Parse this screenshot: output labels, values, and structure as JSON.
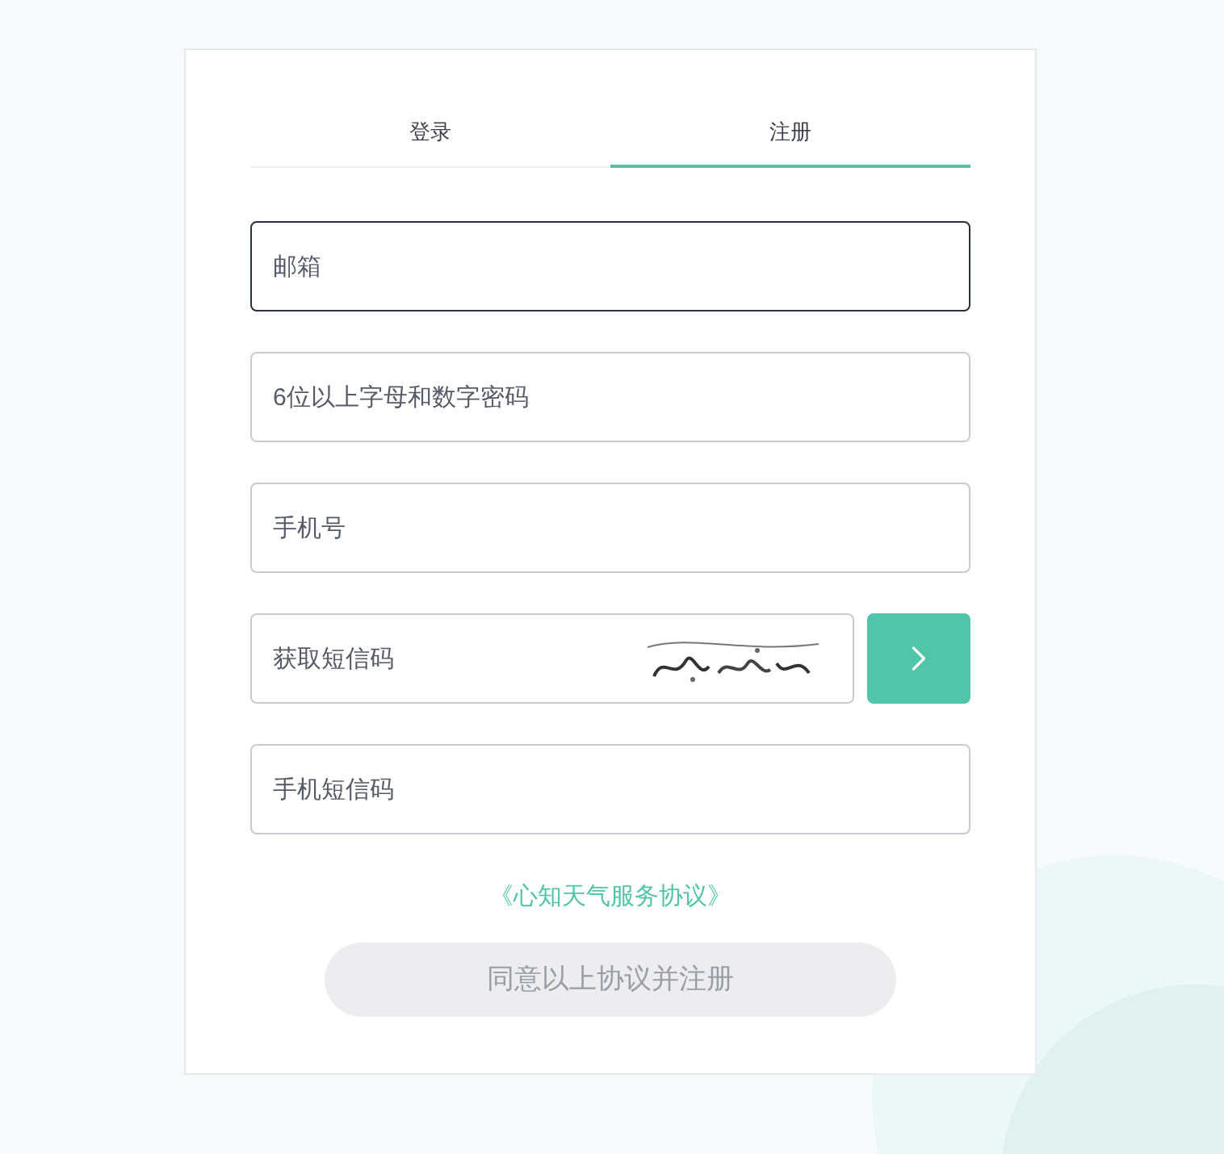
{
  "tabs": [
    {
      "label": "登录",
      "selected": false
    },
    {
      "label": "注册",
      "selected": true
    }
  ],
  "fields": [
    {
      "kind": "text",
      "placeholder": "邮箱",
      "focused": true
    },
    {
      "kind": "text",
      "placeholder": "6位以上字母和数字密码",
      "focused": false
    },
    {
      "kind": "text",
      "placeholder": "手机号",
      "focused": false
    },
    {
      "kind": "captcha",
      "placeholder": "获取短信码",
      "focused": false
    },
    {
      "kind": "text",
      "placeholder": "手机短信码",
      "focused": false
    }
  ],
  "agreement_link": "《心知天气服务协议》",
  "submit": {
    "label": "同意以上协议并注册",
    "disabled": true
  }
}
